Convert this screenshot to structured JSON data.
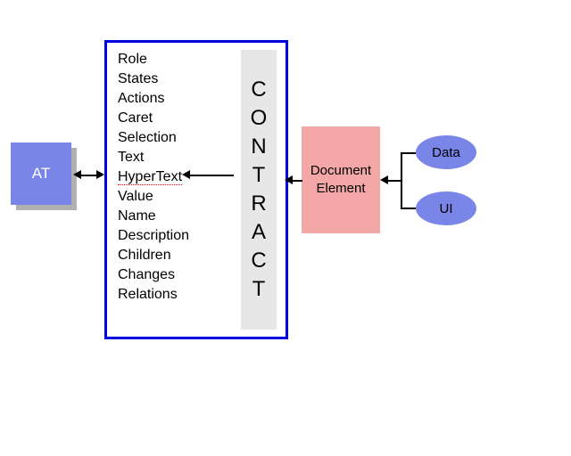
{
  "at": {
    "label": "AT"
  },
  "contract": {
    "properties": [
      {
        "label": "Role",
        "underline": false
      },
      {
        "label": "States",
        "underline": false
      },
      {
        "label": "Actions",
        "underline": false
      },
      {
        "label": "Caret",
        "underline": false
      },
      {
        "label": "Selection",
        "underline": false
      },
      {
        "label": "Text",
        "underline": false
      },
      {
        "label": "HyperText",
        "underline": true
      },
      {
        "label": "Value",
        "underline": false
      },
      {
        "label": "Name",
        "underline": false
      },
      {
        "label": "Description",
        "underline": false
      },
      {
        "label": "Children",
        "underline": false
      },
      {
        "label": "Changes",
        "underline": false
      },
      {
        "label": "Relations",
        "underline": false
      }
    ],
    "strip_letters": [
      "C",
      "O",
      "N",
      "T",
      "R",
      "A",
      "C",
      "T"
    ]
  },
  "document_element": {
    "line1": "Document",
    "line2": "Element"
  },
  "data_node": {
    "label": "Data"
  },
  "ui_node": {
    "label": "UI"
  }
}
